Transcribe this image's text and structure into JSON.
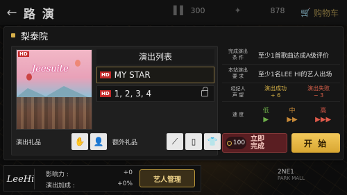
{
  "topbar": {
    "back": "←",
    "title": "路 演",
    "stat1": "300",
    "stat2": "878",
    "shop": "购物车"
  },
  "dialog": {
    "title": "梨泰院",
    "setlist_title": "演出列表",
    "songs": [
      {
        "hd": "HD",
        "name": "MY STAR",
        "selected": true
      },
      {
        "hd": "HD",
        "name": "1, 2, 3, 4",
        "locked": true
      }
    ],
    "album_hd": "HD",
    "album_text": "Jeesuite",
    "gift_label": "演出礼品",
    "extra_gift_label": "额外礼品",
    "requirements": [
      {
        "key": "完成演出\n条 件",
        "value": "至少1首歌曲达成A级评价"
      },
      {
        "key": "本站演出\n要 求",
        "value": "至少1名LEE HI的艺人出场"
      }
    ],
    "reputation": {
      "key": "经纪人\n声 望",
      "success_label": "演出成功",
      "success_value": "+ 6",
      "fail_label": "演出失败",
      "fail_value": "− 3"
    },
    "speed": {
      "key": "速 度",
      "low_label": "低",
      "low_arrows": "▶",
      "mid_label": "中",
      "mid_arrows": "▶▶",
      "high_label": "高",
      "high_arrows": "▶▶▶"
    },
    "instant": {
      "cost": "100",
      "label": "立即\n完成"
    },
    "start_label": "开 始"
  },
  "artist": {
    "logo": "LeeHi",
    "influence_label": "影响力 :",
    "influence_value": "+0",
    "bonus_label": "演出加成 :",
    "bonus_value": "+0%",
    "manage_label": "艺人管理"
  },
  "venue": {
    "name": "2NE1",
    "sub": "PARK MALL"
  }
}
